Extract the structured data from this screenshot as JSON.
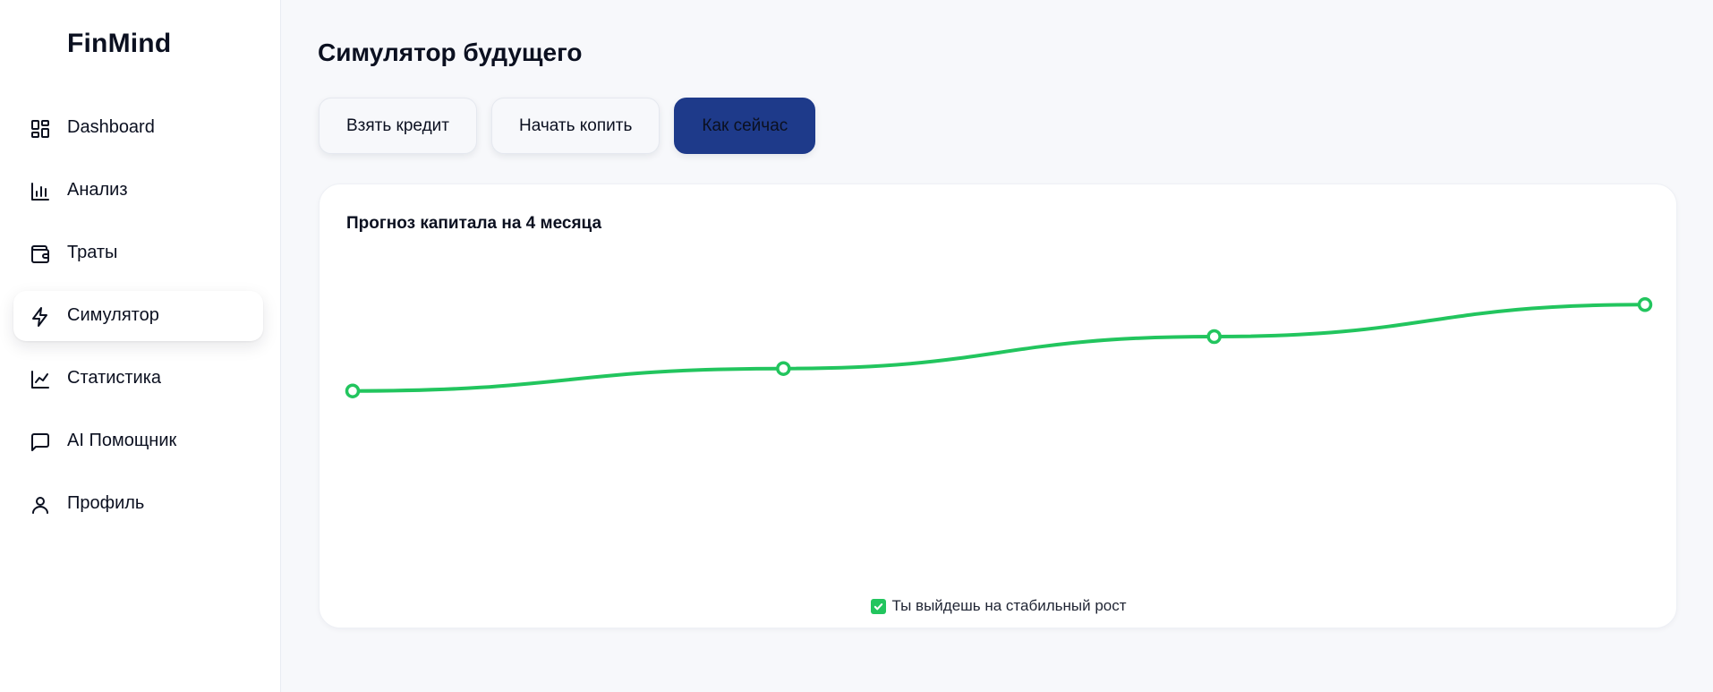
{
  "app": {
    "brand": "FinMind"
  },
  "sidebar": {
    "items": [
      {
        "label": "Dashboard",
        "icon": "dashboard-icon",
        "active": false
      },
      {
        "label": "Анализ",
        "icon": "bar-chart-icon",
        "active": false
      },
      {
        "label": "Траты",
        "icon": "wallet-icon",
        "active": false
      },
      {
        "label": "Симулятор",
        "icon": "lightning-icon",
        "active": true
      },
      {
        "label": "Статистика",
        "icon": "line-chart-icon",
        "active": false
      },
      {
        "label": "AI Помощник",
        "icon": "chat-icon",
        "active": false
      },
      {
        "label": "Профиль",
        "icon": "user-icon",
        "active": false
      }
    ]
  },
  "main": {
    "title": "Симулятор будущего",
    "scenarios": [
      {
        "label": "Взять кредит",
        "active": false
      },
      {
        "label": "Начать копить",
        "active": false
      },
      {
        "label": "Как сейчас",
        "active": true
      }
    ]
  },
  "colors": {
    "accent": "#1e3a8a",
    "line": "#22c55e",
    "background": "#f7f8fb"
  },
  "chart_data": {
    "type": "line",
    "title": "Прогноз капитала на 4 месяца",
    "x": [
      1,
      2,
      3,
      4
    ],
    "series": [
      {
        "values": [
          100,
          107,
          117,
          127
        ]
      }
    ],
    "ylim": [
      40,
      145
    ],
    "grid": false,
    "note": {
      "text": "Ты выйдешь на стабильный рост",
      "icon": "check-icon"
    }
  }
}
